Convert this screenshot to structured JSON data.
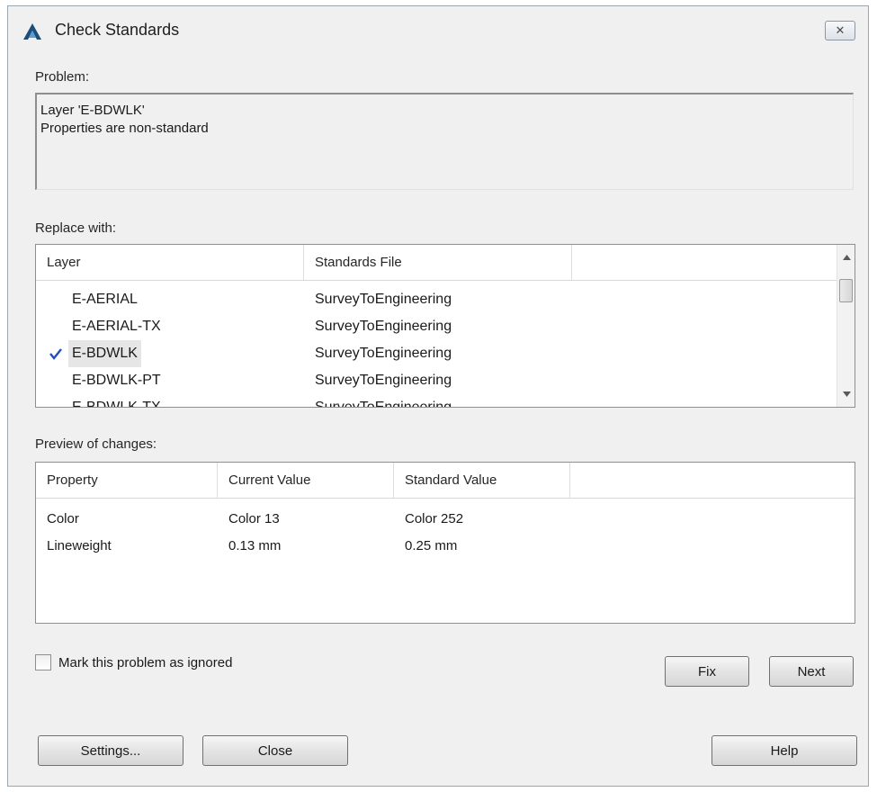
{
  "window": {
    "title": "Check Standards",
    "close_glyph": "✕"
  },
  "problem": {
    "label": "Problem:",
    "lines": [
      "Layer 'E-BDWLK'",
      "Properties are non-standard"
    ]
  },
  "replace": {
    "label": "Replace with:",
    "columns": [
      "Layer",
      "Standards File",
      ""
    ],
    "rows": [
      {
        "layer": "E-AERIAL",
        "file": "SurveyToEngineering",
        "checked": false
      },
      {
        "layer": "E-AERIAL-TX",
        "file": "SurveyToEngineering",
        "checked": false
      },
      {
        "layer": "E-BDWLK",
        "file": "SurveyToEngineering",
        "checked": true
      },
      {
        "layer": "E-BDWLK-PT",
        "file": "SurveyToEngineering",
        "checked": false
      },
      {
        "layer": "E-BDWLK-TX",
        "file": "SurveyToEngineering",
        "checked": false
      }
    ]
  },
  "preview": {
    "label": "Preview of changes:",
    "columns": [
      "Property",
      "Current Value",
      "Standard Value",
      ""
    ],
    "rows": [
      {
        "property": "Color",
        "current": "Color 13",
        "standard": "Color 252"
      },
      {
        "property": "Lineweight",
        "current": "0.13 mm",
        "standard": "0.25 mm"
      }
    ]
  },
  "ignore_checkbox": {
    "label": "Mark this problem as ignored",
    "checked": false
  },
  "buttons": {
    "fix": "Fix",
    "next": "Next",
    "settings": "Settings...",
    "close": "Close",
    "help": "Help"
  },
  "colors": {
    "check": "#1f4fbf",
    "icon": "#1b4f7a"
  }
}
